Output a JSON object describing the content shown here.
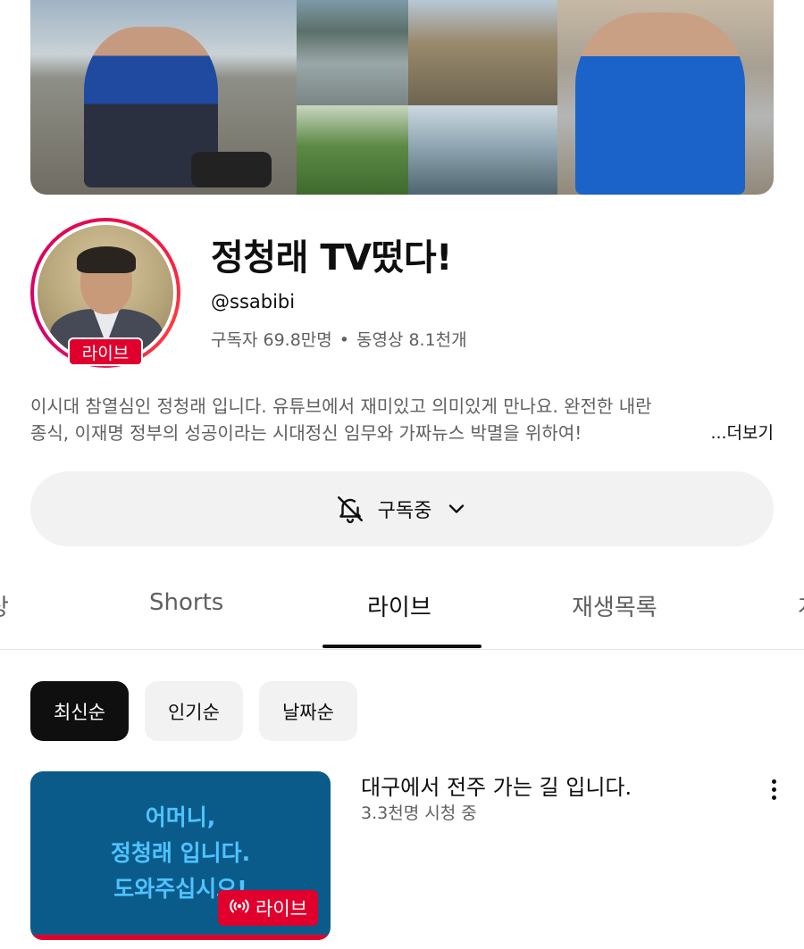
{
  "channel": {
    "title": "정청래 TV떴다!",
    "handle": "@ssabibi",
    "subscribers": "구독자 69.8만명",
    "separator": "•",
    "videos": "동영상 8.1천개",
    "live_badge": "라이브",
    "description_line1": "이시대 참열심인 정청래 입니다. 유튜브에서 재미있고 의미있게 만나요.  완전한 내란",
    "description_line2": "종식, 이재명 정부의 성공이라는 시대정신 임무와 가짜뉴스 박멸을 위하여! ",
    "more_label": "...더보기"
  },
  "subscribe": {
    "label": "구독중",
    "bell_icon": "bell-off-icon",
    "chevron_icon": "chevron-down-icon"
  },
  "tabs": [
    {
      "label": "상"
    },
    {
      "label": "Shorts"
    },
    {
      "label": "라이브",
      "active": true
    },
    {
      "label": "재생목록"
    },
    {
      "label": "게"
    }
  ],
  "chips": [
    {
      "label": "최신순",
      "selected": true
    },
    {
      "label": "인기순"
    },
    {
      "label": "날짜순"
    }
  ],
  "videos": [
    {
      "title": "대구에서 전주 가는 길 입니다.",
      "meta": "3.3천명 시청 중",
      "thumb_line1": "어머니,",
      "thumb_line2": "정청래 입니다.",
      "thumb_line3": "도와주십시오!",
      "live_label": "라이브"
    }
  ],
  "colors": {
    "live_red": "#e1002d",
    "thumb_bg": "#0b5b8a",
    "thumb_text": "#4fc3ff"
  }
}
